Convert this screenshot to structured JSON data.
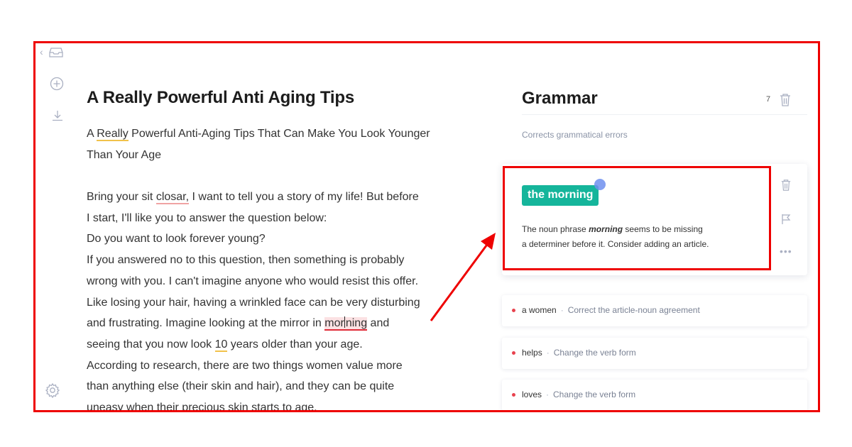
{
  "doc": {
    "title": "A Really Powerful Anti Aging Tips",
    "line1": [
      "A ",
      "Really",
      " Powerful Anti-Aging Tips That Can Make You Look Younger"
    ],
    "line2": "Than Your Age",
    "line3": [
      "Bring your sit ",
      "closar,",
      " I want to tell you a story of my life! But before"
    ],
    "line4": "I start, I'll like you to answer the question below:",
    "line5": "Do you want to look forever young?",
    "line6": "If you answered no to this question, then something is probably",
    "line7": "wrong with you. I can't imagine anyone who would resist this offer.",
    "line8": "Like losing your hair, having a wrinkled face can be very disturbing",
    "line9": [
      "and frustrating. Imagine looking at the mirror in ",
      "mor",
      "ning",
      " and"
    ],
    "line10": [
      "seeing that you now look ",
      "10",
      " years older than your age."
    ],
    "line11": "According to research, there are two things women value more",
    "line12": "than anything else (their skin and hair), and they can be quite",
    "line13": "uneasy when their precious skin starts to age."
  },
  "panel": {
    "title": "Grammar",
    "count": "7",
    "subtitle": "Corrects grammatical errors",
    "card": {
      "suggestion": "the morning",
      "desc_a": "The noun phrase ",
      "desc_word": "morning",
      "desc_b": " seems to be missing",
      "desc_line2": "a determiner before it. Consider adding an article.",
      "more": "•••"
    },
    "items": [
      {
        "word": "a women",
        "sep": "·",
        "hint": "Correct the article-noun agreement"
      },
      {
        "word": "helps",
        "sep": "·",
        "hint": "Change the verb form"
      },
      {
        "word": "loves",
        "sep": "·",
        "hint": "Change the verb form"
      }
    ]
  },
  "rail": {
    "back": "‹"
  },
  "colors": {
    "accent": "#15b59b",
    "annotation": "#ee0000",
    "error": "#e8424e"
  },
  "icons": [
    "chevron-left-icon",
    "inbox-icon",
    "plus-circle-icon",
    "download-icon",
    "gear-icon",
    "trash-icon",
    "flag-icon",
    "more-icon"
  ]
}
